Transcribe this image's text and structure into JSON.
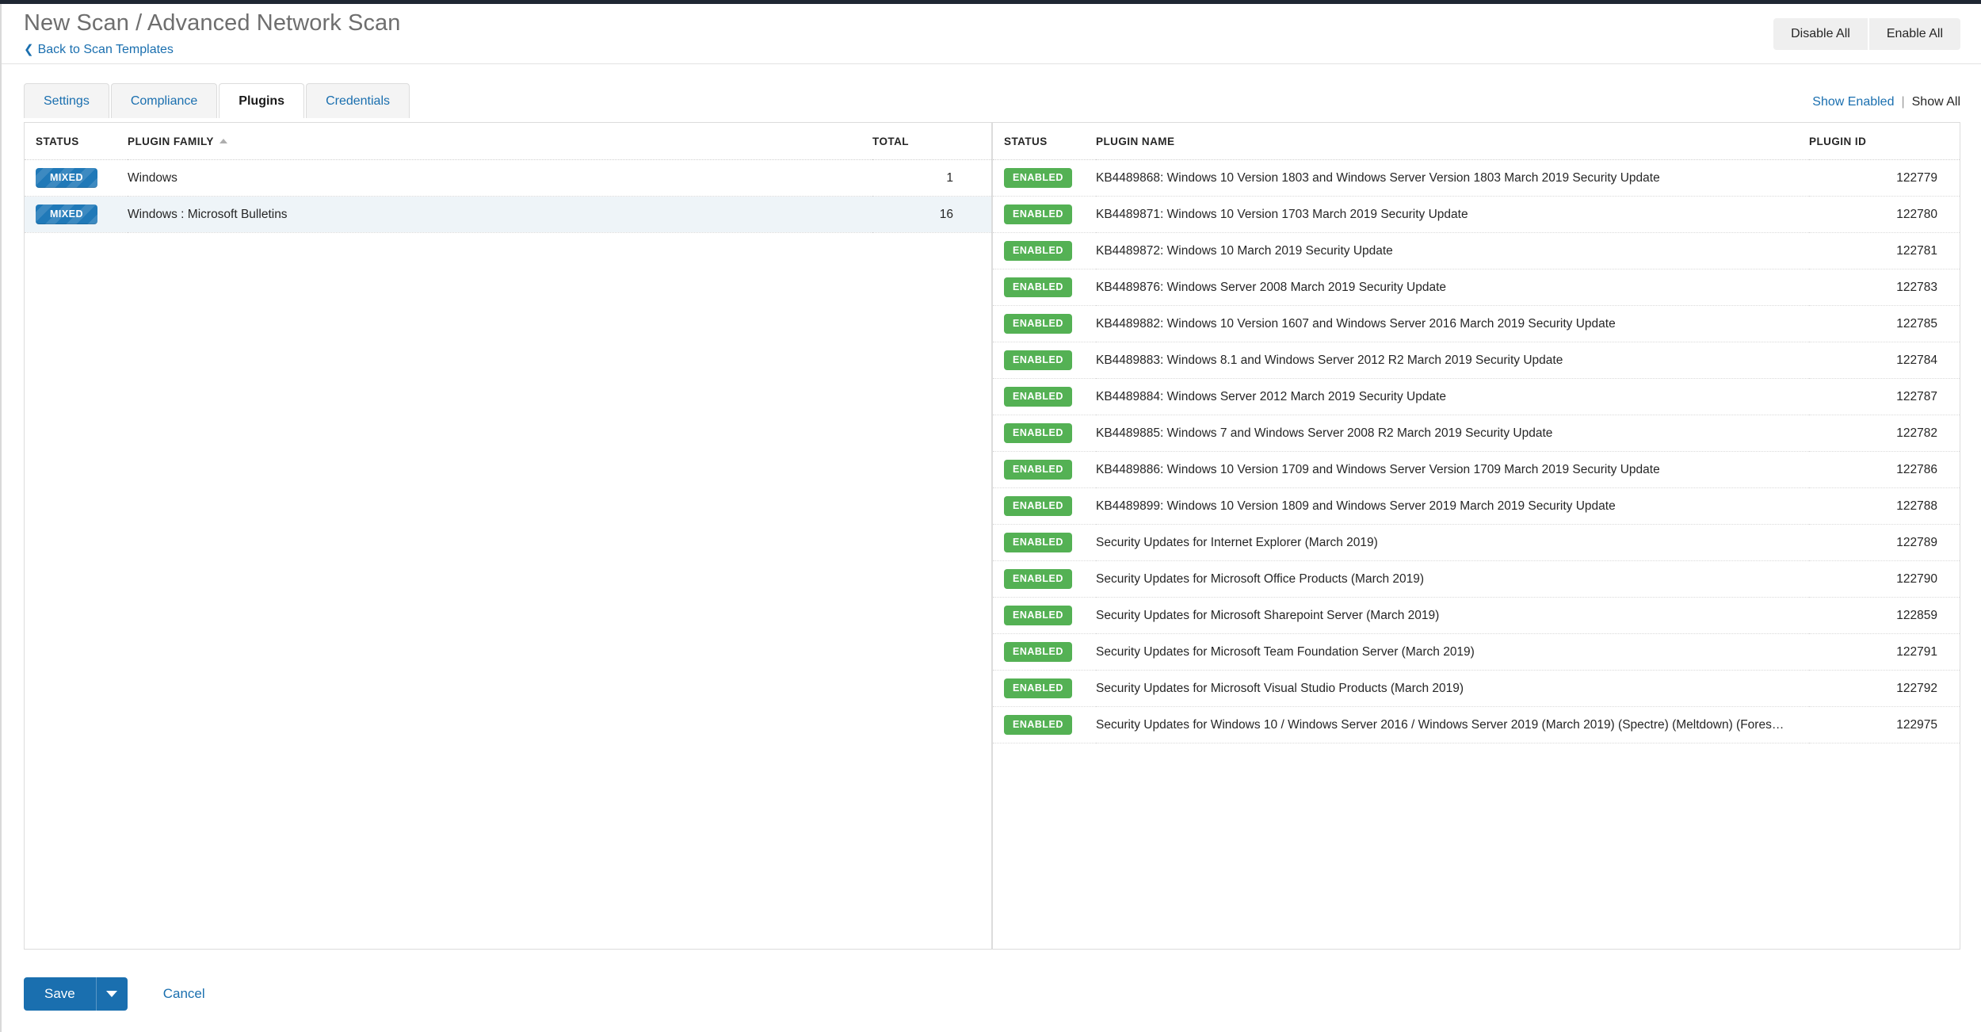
{
  "header": {
    "title": "New Scan / Advanced Network Scan",
    "back_link": "Back to Scan Templates",
    "back_icon": "chevron-left-icon",
    "disable_all": "Disable All",
    "enable_all": "Enable All"
  },
  "tabs": [
    {
      "label": "Settings",
      "active": false
    },
    {
      "label": "Compliance",
      "active": false
    },
    {
      "label": "Plugins",
      "active": true
    },
    {
      "label": "Credentials",
      "active": false
    }
  ],
  "filters": {
    "show_enabled": "Show Enabled",
    "separator": "|",
    "show_all": "Show All"
  },
  "families_table": {
    "columns": [
      "STATUS",
      "PLUGIN FAMILY",
      "TOTAL"
    ],
    "sort_column": "PLUGIN FAMILY",
    "sort_direction": "asc",
    "rows": [
      {
        "status": "MIXED",
        "family": "Windows",
        "total": "1",
        "selected": false
      },
      {
        "status": "MIXED",
        "family": "Windows : Microsoft Bulletins",
        "total": "16",
        "selected": true
      }
    ]
  },
  "plugins_table": {
    "columns": [
      "STATUS",
      "PLUGIN NAME",
      "PLUGIN ID"
    ],
    "rows": [
      {
        "status": "ENABLED",
        "name": "KB4489868: Windows 10 Version 1803 and Windows Server Version 1803 March 2019 Security Update",
        "id": "122779"
      },
      {
        "status": "ENABLED",
        "name": "KB4489871: Windows 10 Version 1703 March 2019 Security Update",
        "id": "122780"
      },
      {
        "status": "ENABLED",
        "name": "KB4489872: Windows 10 March 2019 Security Update",
        "id": "122781"
      },
      {
        "status": "ENABLED",
        "name": "KB4489876: Windows Server 2008 March 2019 Security Update",
        "id": "122783"
      },
      {
        "status": "ENABLED",
        "name": "KB4489882: Windows 10 Version 1607 and Windows Server 2016 March 2019 Security Update",
        "id": "122785"
      },
      {
        "status": "ENABLED",
        "name": "KB4489883: Windows 8.1 and Windows Server 2012 R2 March 2019 Security Update",
        "id": "122784"
      },
      {
        "status": "ENABLED",
        "name": "KB4489884: Windows Server 2012 March 2019 Security Update",
        "id": "122787"
      },
      {
        "status": "ENABLED",
        "name": "KB4489885: Windows 7 and Windows Server 2008 R2 March 2019 Security Update",
        "id": "122782"
      },
      {
        "status": "ENABLED",
        "name": "KB4489886: Windows 10 Version 1709 and Windows Server Version 1709 March 2019 Security Update",
        "id": "122786"
      },
      {
        "status": "ENABLED",
        "name": "KB4489899: Windows 10 Version 1809 and Windows Server 2019 March 2019 Security Update",
        "id": "122788"
      },
      {
        "status": "ENABLED",
        "name": "Security Updates for Internet Explorer (March 2019)",
        "id": "122789"
      },
      {
        "status": "ENABLED",
        "name": "Security Updates for Microsoft Office Products (March 2019)",
        "id": "122790"
      },
      {
        "status": "ENABLED",
        "name": "Security Updates for Microsoft Sharepoint Server (March 2019)",
        "id": "122859"
      },
      {
        "status": "ENABLED",
        "name": "Security Updates for Microsoft Team Foundation Server (March 2019)",
        "id": "122791"
      },
      {
        "status": "ENABLED",
        "name": "Security Updates for Microsoft Visual Studio Products (March 2019)",
        "id": "122792"
      },
      {
        "status": "ENABLED",
        "name": "Security Updates for Windows 10 / Windows Server 2016 / Windows Server 2019 (March 2019) (Spectre) (Meltdown) (Fores…",
        "id": "122975"
      }
    ]
  },
  "footer": {
    "save": "Save",
    "save_caret_icon": "caret-down-icon",
    "cancel": "Cancel"
  },
  "colors": {
    "link": "#1a6faf",
    "primary": "#1a6faf",
    "badge_mixed": "#2079b8",
    "badge_enabled": "#54b154",
    "selected_row": "#eef4f8"
  }
}
